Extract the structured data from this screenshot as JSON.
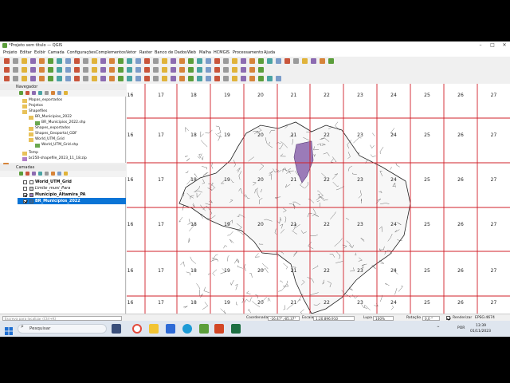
{
  "window": {
    "title": "*Projeto sem título — QGIS"
  },
  "menu": [
    "Projeto",
    "Editar",
    "Exibir",
    "Camada",
    "Configurações",
    "Complementos",
    "Vetor",
    "Raster",
    "Banco de Dados",
    "Web",
    "Malha",
    "HCMGIS",
    "Processamento",
    "Ajuda"
  ],
  "browser": {
    "title": "Navegador",
    "items": [
      "Mapas_exportados",
      "Projetos",
      "Shapefiles",
      "BR_Municipios_2022",
      "BR_Municipios_2022.shp",
      "Shapes_exportados",
      "Shapes_Geoportal_GDF",
      "World_UTM_Grid",
      "World_UTM_Grid.shp",
      "Temp",
      "br250-shapefile_2023_11_18.zip"
    ]
  },
  "layers": {
    "title": "Camadas",
    "items": [
      {
        "name": "World_UTM_Grid",
        "checked": false,
        "color": "#ffffff",
        "bold": true,
        "selected": false
      },
      {
        "name": "Limite_muni_Para",
        "checked": false,
        "color": "#cccccc",
        "bold": false,
        "selected": false
      },
      {
        "name": "Município_Altamira_PA",
        "checked": true,
        "color": "#9b7bb8",
        "bold": true,
        "selected": false
      },
      {
        "name": "BR_Municípios_2022",
        "checked": true,
        "color": "#1e6ab8",
        "bold": true,
        "selected": true
      }
    ]
  },
  "map": {
    "zone_rows": [
      [
        "16",
        "17",
        "18",
        "19",
        "20",
        "21",
        "22",
        "23",
        "24",
        "25",
        "26",
        "27"
      ],
      [
        "16",
        "17",
        "18",
        "19",
        "20",
        "21",
        "22",
        "23",
        "24",
        "25",
        "26",
        "27"
      ],
      [
        "16",
        "17",
        "18",
        "19",
        "20",
        "21",
        "22",
        "23",
        "24",
        "25",
        "26",
        "27"
      ],
      [
        "16",
        "17",
        "18",
        "19",
        "20",
        "21",
        "22",
        "23",
        "24",
        "25",
        "26",
        "27"
      ],
      [
        "16",
        "17",
        "18",
        "19",
        "20",
        "21",
        "22",
        "23",
        "24",
        "25",
        "26",
        "27"
      ],
      [
        "16",
        "17",
        "18",
        "19",
        "20",
        "21",
        "22",
        "23",
        "24",
        "25",
        "26",
        "27"
      ]
    ],
    "grid_color": "#d0202a",
    "highlight_color": "#9b7bb8"
  },
  "status": {
    "locator_placeholder": "Escreva para localizar (Ctrl+K)",
    "coord_label": "Coordenada",
    "coord_value": "-16.47°,-85.37°",
    "scale_label": "Escala",
    "scale_value": "1:20.896.910",
    "magnifier_label": "Lupa",
    "magnifier_value": "100%",
    "rotation_label": "Rotação",
    "rotation_value": "0,0 °",
    "render_label": "Renderizar",
    "crs": "EPSG:4674"
  },
  "taskbar": {
    "search_label": "Pesquisar",
    "lang": "POR",
    "time": "13:39",
    "date": "01/11/2023"
  }
}
